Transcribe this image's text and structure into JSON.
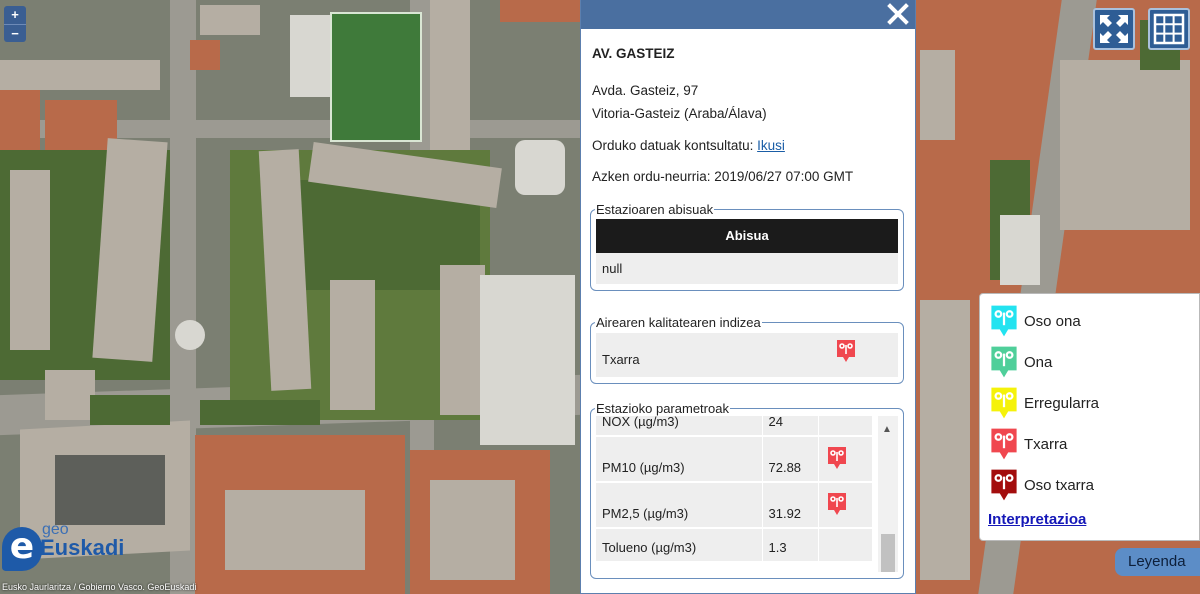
{
  "map": {
    "zoom_in": "+",
    "zoom_out": "−",
    "attribution": "Eusko Jaurlaritza / Gobierno Vasco. GeoEuskadi",
    "logo_geo": "geo",
    "logo_euskadi": "Euskadi",
    "logo_mark": "e"
  },
  "popup": {
    "station_name": "AV. GASTEIZ",
    "address_line1": "Avda. Gasteiz, 97",
    "address_line2": "Vitoria-Gasteiz (Araba/Álava)",
    "hourly_data_label": "Orduko datuak kontsultatu:",
    "hourly_data_link": "Ikusi",
    "last_measurement": "Azken ordu-neurria: 2019/06/27 07:00 GMT",
    "warnings": {
      "legend": "Estazioaren abisuak",
      "header": "Abisua",
      "value": "null"
    },
    "aqi": {
      "legend": "Airearen kalitatearen indizea",
      "value": "Txarra",
      "color": "#f0474f"
    },
    "params": {
      "legend": "Estazioko parametroak",
      "rows": [
        {
          "name": "NOX (µg/m3)",
          "value": "24"
        },
        {
          "name": "PM10 (µg/m3)",
          "value": "72.88"
        },
        {
          "name": "PM2,5 (µg/m3)",
          "value": "31.92"
        },
        {
          "name": "Tolueno (µg/m3)",
          "value": "1.3"
        }
      ]
    }
  },
  "legend": {
    "items": [
      {
        "label": "Oso ona",
        "color": "#23e3f0"
      },
      {
        "label": "Ona",
        "color": "#4fcf9a"
      },
      {
        "label": "Erregularra",
        "color": "#f5f20a"
      },
      {
        "label": "Txarra",
        "color": "#f0474f"
      },
      {
        "label": "Oso txarra",
        "color": "#a30d0d"
      }
    ],
    "link": "Interpretazioa",
    "button": "Leyenda"
  },
  "colors": {
    "popup_bar": "#4a6fa0",
    "tool_button": "#2e5d95",
    "link": "#1a5da6"
  }
}
